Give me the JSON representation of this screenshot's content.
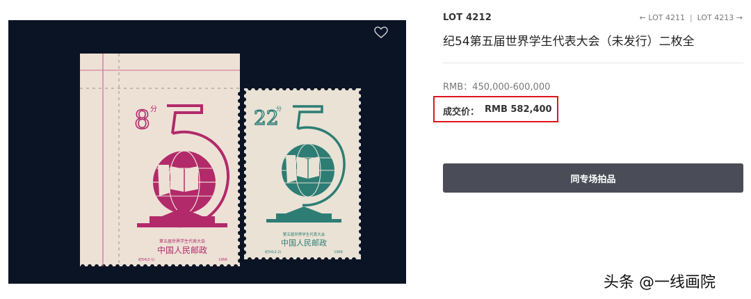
{
  "lot": {
    "number": "LOT 4212",
    "prev": "← LOT 4211",
    "separator": "|",
    "next": "LOT 4213 →",
    "title": "纪54第五届世界学生代表大会（未发行）二枚全"
  },
  "estimate": "RMB：450,000-600,000",
  "hammer": {
    "label": "成交价：",
    "value": "RMB 582,400"
  },
  "button_label": "同专场拍品",
  "watermark": "头条 @一线画院",
  "image": {
    "panel_color": "#0b1424",
    "stamps": [
      {
        "name": "left-stamp",
        "denomination": "8",
        "denomination_suffix": "分",
        "ink": "#b22a6a",
        "paper": "#ede1d6",
        "year": "1956",
        "caption": "第五届世界学生代表大会",
        "country": "中国人民邮政",
        "code_left": "纪54(2-1)",
        "code_right": "1956"
      },
      {
        "name": "right-stamp",
        "denomination": "22",
        "denomination_suffix": "分",
        "ink": "#2d7d74",
        "paper": "#e9e2d5",
        "year": "1956",
        "caption": "第五届世界学生代表大会",
        "country": "中国人民邮政",
        "code_left": "纪54(2-2)",
        "code_right": "1956"
      }
    ]
  },
  "colors": {
    "accent": "#e0141e",
    "button": "#4a4d57"
  }
}
